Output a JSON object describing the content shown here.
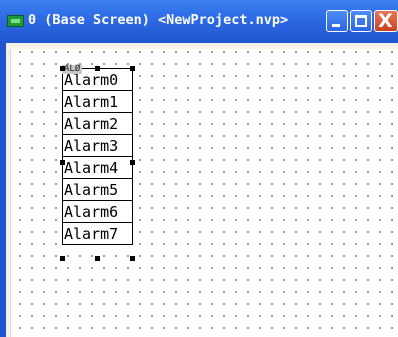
{
  "window": {
    "title": "0 (Base Screen) <NewProject.nvp>",
    "icon": "screen-icon",
    "controls": {
      "minimize_icon": "minimize-icon",
      "maximize_icon": "maximize-icon",
      "close_icon": "close-icon",
      "close_glyph": "X"
    }
  },
  "canvas": {
    "alarm_object": {
      "tag": "ALØ",
      "rows": [
        "Alarm0",
        "Alarm1",
        "Alarm2",
        "Alarm3",
        "Alarm4",
        "Alarm5",
        "Alarm6",
        "Alarm7"
      ]
    }
  },
  "colors": {
    "titlebar": "#2d6ae4",
    "close_button": "#d0512d",
    "grid_dot": "#7a7a7a"
  }
}
